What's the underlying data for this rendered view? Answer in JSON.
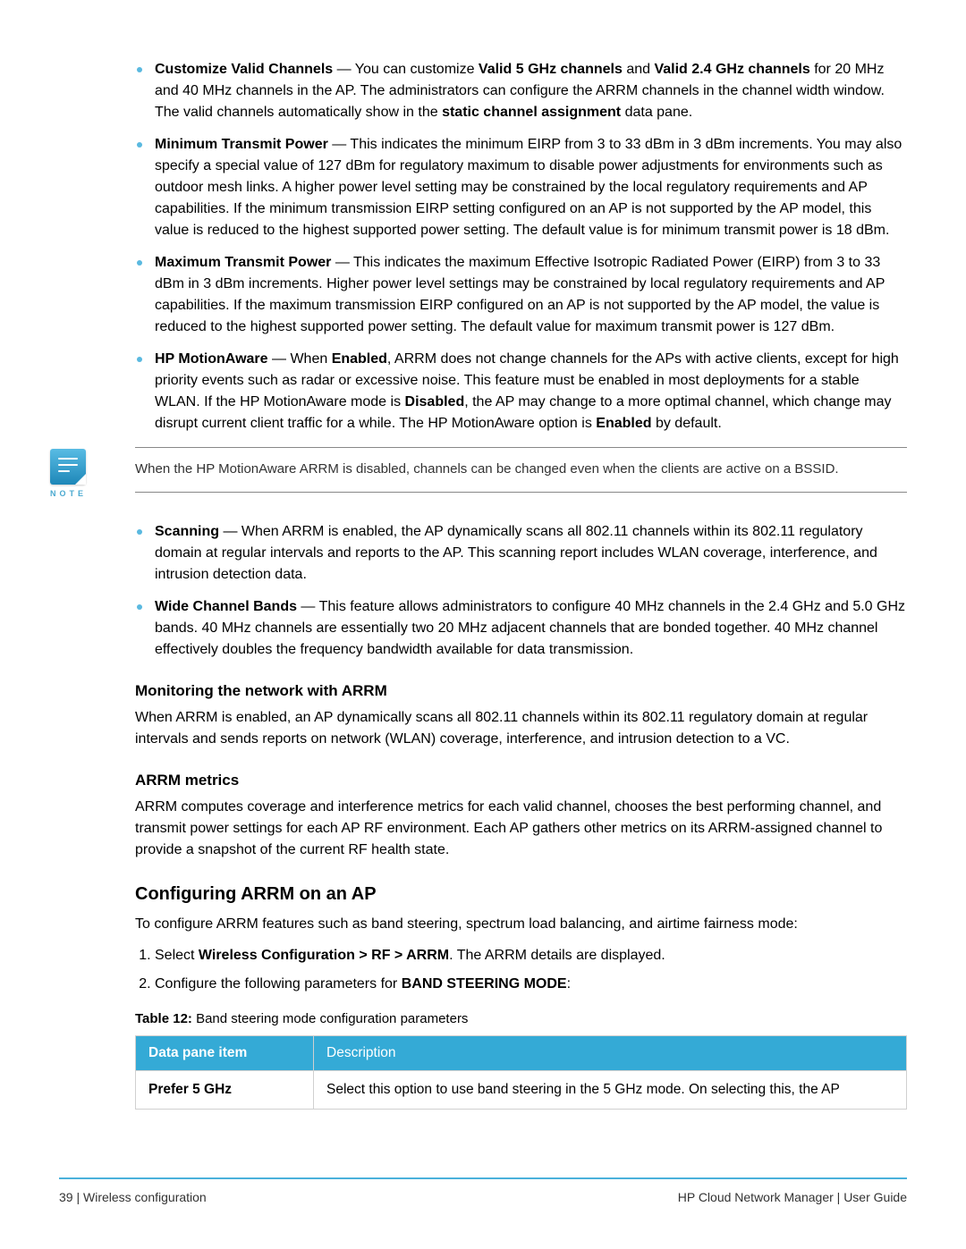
{
  "bullets_top": [
    {
      "title": "Customize Valid Channels",
      "text_html": "— You can customize <b>Valid 5 GHz channels</b> and <b>Valid 2.4 GHz channels</b> for 20 MHz and 40 MHz channels in the AP. The administrators can configure the ARRM channels in the channel width window. The valid channels automatically show in the <b>static channel assignment</b> data pane."
    },
    {
      "title": "Minimum Transmit Power",
      "text_html": "— This indicates the minimum EIRP from 3 to 33 dBm in 3 dBm increments. You may also specify a special value of 127 dBm for regulatory maximum to disable power adjustments for environments such as outdoor mesh links. A higher power level setting may be constrained by the local regulatory requirements and AP capabilities. If the minimum transmission EIRP setting configured on an AP is not supported by the AP model, this value is reduced to the highest supported power setting. The default value is for minimum transmit power is 18 dBm."
    },
    {
      "title": "Maximum Transmit Power",
      "text_html": "— This indicates the maximum Effective Isotropic Radiated Power (EIRP) from 3 to 33 dBm in 3 dBm increments. Higher power level settings may be constrained by local regulatory requirements and AP capabilities. If the maximum transmission EIRP configured on an AP is not supported by the AP model, the value is reduced to the highest supported power setting. The default value for maximum transmit power is 127 dBm."
    },
    {
      "title": "HP MotionAware",
      "text_html": "— When <b>Enabled</b>, ARRM does not change channels for the APs with active clients, except for high priority events such as radar or excessive noise. This feature must be enabled in most deployments for a stable WLAN. If the HP MotionAware mode is <b>Disabled</b>, the AP may change to a more optimal channel, which change may disrupt current client traffic for a while. The HP MotionAware option is <b>Enabled</b> by default."
    }
  ],
  "note": {
    "label": "NOTE",
    "text": "When the HP MotionAware ARRM is disabled, channels can be changed even when the clients are active on a BSSID."
  },
  "bullets_after_note": [
    {
      "title": "Scanning",
      "text_html": "— When ARRM is enabled, the AP dynamically scans all 802.11 channels within its 802.11 regulatory domain at regular intervals and reports to the AP. This scanning report includes WLAN coverage, interference, and intrusion detection data."
    },
    {
      "title": "Wide Channel Bands",
      "text_html": "— This feature allows administrators to configure 40 MHz channels in the 2.4 GHz and 5.0 GHz bands. 40 MHz channels are essentially two 20 MHz adjacent channels that are bonded together. 40 MHz channel effectively doubles the frequency bandwidth available for data transmission."
    }
  ],
  "monitoring": {
    "heading": "Monitoring the network with ARRM",
    "text": "When ARRM is enabled, an AP dynamically scans all 802.11 channels within its 802.11 regulatory domain at regular intervals and sends reports on network (WLAN) coverage, interference, and intrusion detection to a VC."
  },
  "metrics": {
    "heading": "ARRM metrics",
    "text": "ARRM computes coverage and interference metrics for each valid channel, chooses the best performing channel, and transmit power settings for each AP RF environment. Each AP gathers other metrics on its ARRM-assigned channel to provide a snapshot of the current RF health state."
  },
  "configuring": {
    "heading": "Configuring ARRM on an AP",
    "intro": "To configure ARRM features such as band steering, spectrum load balancing, and airtime fairness mode:",
    "steps": [
      "Select <b>Wireless Configuration > RF > ARRM</b>. The ARRM details are displayed.",
      "Configure the following parameters for <b>BAND STEERING MODE</b>:"
    ],
    "table_caption_label": "Table 12:",
    "table_caption_text": " Band steering mode configuration parameters",
    "table_headers": {
      "c1": "Data pane item",
      "c2": "Description"
    },
    "table_rows": [
      {
        "item": "Prefer 5 GHz",
        "desc": "Select this option to use band steering in the 5 GHz mode. On selecting this, the AP"
      }
    ]
  },
  "footer": {
    "left": "39 | Wireless configuration",
    "right": "HP Cloud Network Manager | User Guide"
  }
}
